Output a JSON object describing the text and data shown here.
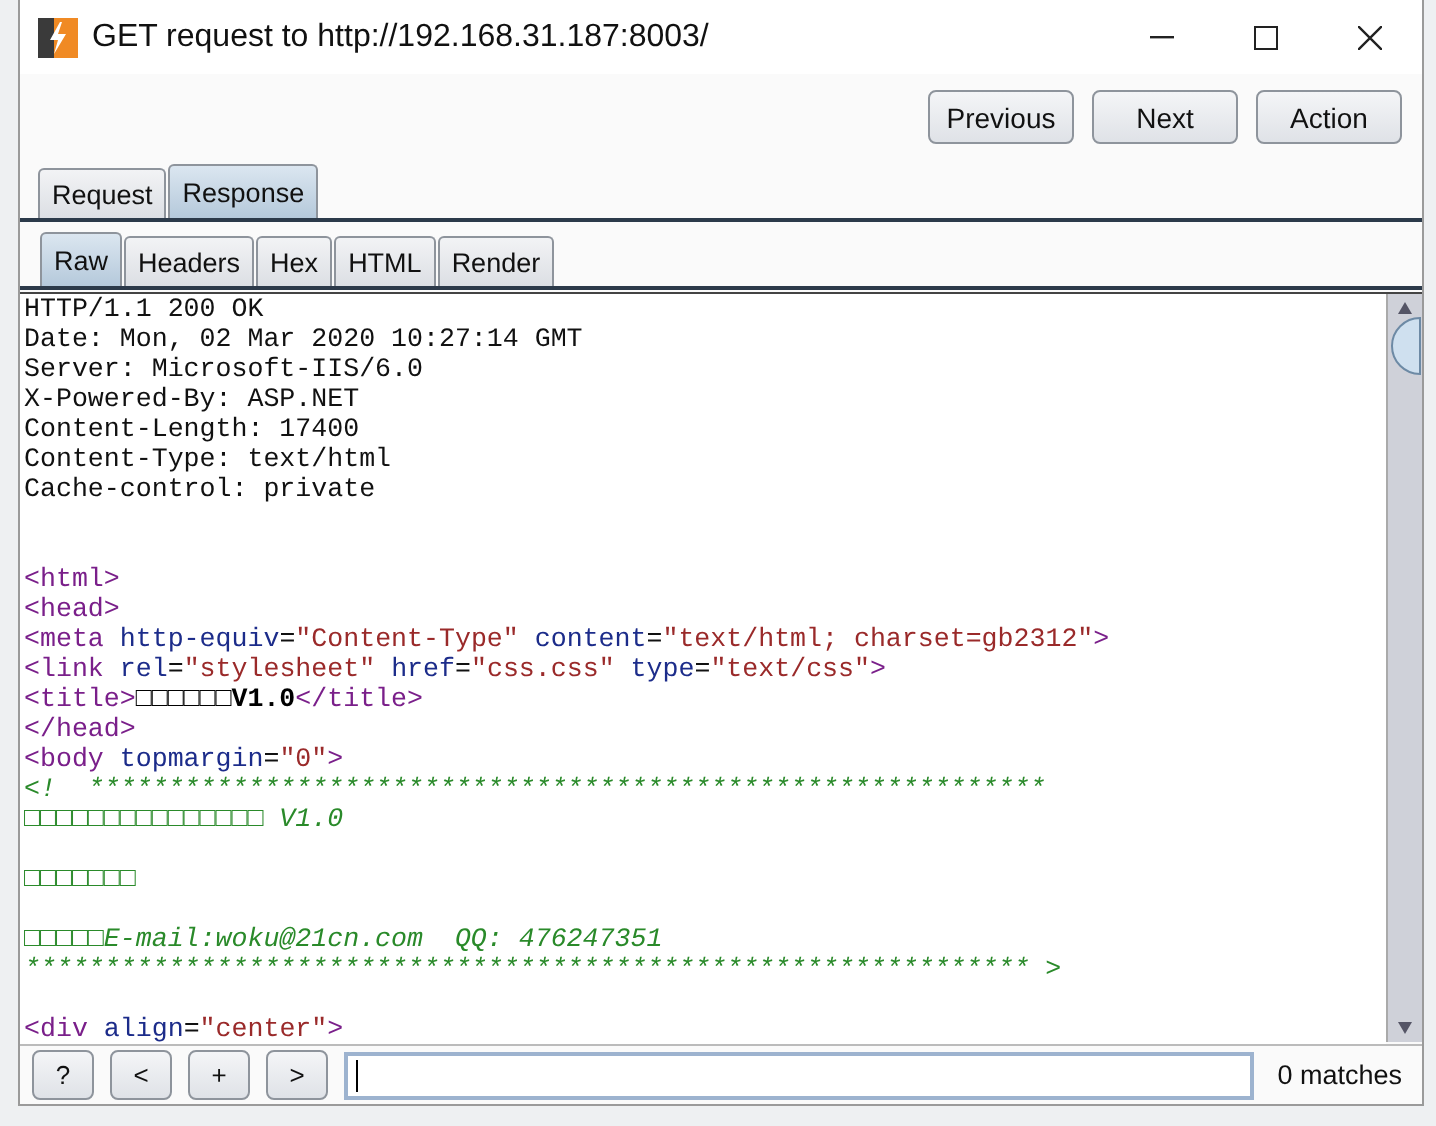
{
  "window": {
    "title": "GET request to http://192.168.31.187:8003/"
  },
  "nav_buttons": [
    "Previous",
    "Next",
    "Action"
  ],
  "message_tabs": [
    {
      "label": "Request",
      "selected": false
    },
    {
      "label": "Response",
      "selected": true
    }
  ],
  "view_tabs": [
    {
      "label": "Raw",
      "selected": true
    },
    {
      "label": "Headers",
      "selected": false
    },
    {
      "label": "Hex",
      "selected": false
    },
    {
      "label": "HTML",
      "selected": false
    },
    {
      "label": "Render",
      "selected": false
    }
  ],
  "editor": {
    "lines": [
      {
        "kind": "code",
        "tokens": [
          {
            "kind": "plain",
            "text": "HTTP/1.1 200 OK"
          }
        ]
      },
      {
        "kind": "code",
        "tokens": [
          {
            "kind": "plain",
            "text": "Date: Mon, 02 Mar 2020 10:27:14 GMT"
          }
        ]
      },
      {
        "kind": "code",
        "tokens": [
          {
            "kind": "plain",
            "text": "Server: Microsoft-IIS/6.0"
          }
        ]
      },
      {
        "kind": "code",
        "tokens": [
          {
            "kind": "plain",
            "text": "X-Powered-By: ASP.NET"
          }
        ]
      },
      {
        "kind": "code",
        "tokens": [
          {
            "kind": "plain",
            "text": "Content-Length: 17400"
          }
        ]
      },
      {
        "kind": "code",
        "tokens": [
          {
            "kind": "plain",
            "text": "Content-Type: text/html"
          }
        ]
      },
      {
        "kind": "code",
        "tokens": [
          {
            "kind": "plain",
            "text": "Cache-control: private"
          }
        ]
      },
      {
        "kind": "blank"
      },
      {
        "kind": "blank"
      },
      {
        "kind": "code",
        "tokens": [
          {
            "kind": "tag",
            "text": "<html>"
          }
        ]
      },
      {
        "kind": "code",
        "tokens": [
          {
            "kind": "tag",
            "text": "<head>"
          }
        ]
      },
      {
        "kind": "code",
        "tokens": [
          {
            "kind": "tag",
            "text": "<meta"
          },
          {
            "kind": "attr",
            "text": "http-equiv"
          },
          {
            "kind": "plain",
            "text": "="
          },
          {
            "kind": "value",
            "text": "\"Content-Type\""
          },
          {
            "kind": "attr",
            "text": "content"
          },
          {
            "kind": "plain",
            "text": "="
          },
          {
            "kind": "value",
            "text": "\"text/html; charset=gb2312\""
          },
          {
            "kind": "tag",
            "text": ">"
          }
        ]
      },
      {
        "kind": "code",
        "tokens": [
          {
            "kind": "tag",
            "text": "<link"
          },
          {
            "kind": "attr",
            "text": "rel"
          },
          {
            "kind": "plain",
            "text": "="
          },
          {
            "kind": "value",
            "text": "\"stylesheet\""
          },
          {
            "kind": "attr",
            "text": "href"
          },
          {
            "kind": "plain",
            "text": "="
          },
          {
            "kind": "value",
            "text": "\"css.css\""
          },
          {
            "kind": "attr",
            "text": "type"
          },
          {
            "kind": "plain",
            "text": "="
          },
          {
            "kind": "value",
            "text": "\"text/css\""
          },
          {
            "kind": "tag",
            "text": ">"
          }
        ]
      },
      {
        "kind": "code",
        "tokens": [
          {
            "kind": "tag",
            "text": "<title>"
          },
          {
            "kind": "bold",
            "text": "□□□□□□V1.0"
          },
          {
            "kind": "tag",
            "text": "</title>"
          }
        ]
      },
      {
        "kind": "code",
        "tokens": [
          {
            "kind": "tag",
            "text": "</head>"
          }
        ]
      },
      {
        "kind": "code",
        "tokens": [
          {
            "kind": "tag",
            "text": "<body"
          },
          {
            "kind": "attr",
            "text": "topmargin"
          },
          {
            "kind": "plain",
            "text": "="
          },
          {
            "kind": "value",
            "text": "\"0\""
          },
          {
            "kind": "tag",
            "text": ">"
          }
        ]
      },
      {
        "kind": "code",
        "tokens": [
          {
            "kind": "comment",
            "text": "<!  ************************************************************"
          }
        ]
      },
      {
        "kind": "code",
        "tokens": [
          {
            "kind": "comment",
            "text": "□□□□□□□□□□□□□□□ V1.0"
          }
        ]
      },
      {
        "kind": "blank"
      },
      {
        "kind": "code",
        "tokens": [
          {
            "kind": "comment",
            "text": "□□□□□□□"
          }
        ]
      },
      {
        "kind": "blank"
      },
      {
        "kind": "code",
        "tokens": [
          {
            "kind": "comment",
            "text": "□□□□□E-mail:woku@21cn.com  QQ: 476247351"
          }
        ]
      },
      {
        "kind": "code",
        "tokens": [
          {
            "kind": "comment",
            "text": "*************************************************************** >"
          }
        ]
      },
      {
        "kind": "blank"
      },
      {
        "kind": "code",
        "tokens": [
          {
            "kind": "tag",
            "text": "<div"
          },
          {
            "kind": "attr",
            "text": "align"
          },
          {
            "kind": "plain",
            "text": "="
          },
          {
            "kind": "value",
            "text": "\"center\""
          },
          {
            "kind": "tag",
            "text": ">"
          }
        ]
      }
    ]
  },
  "search_bar": {
    "buttons": [
      "?",
      "<",
      "+",
      ">"
    ],
    "matches": "0 matches"
  }
}
